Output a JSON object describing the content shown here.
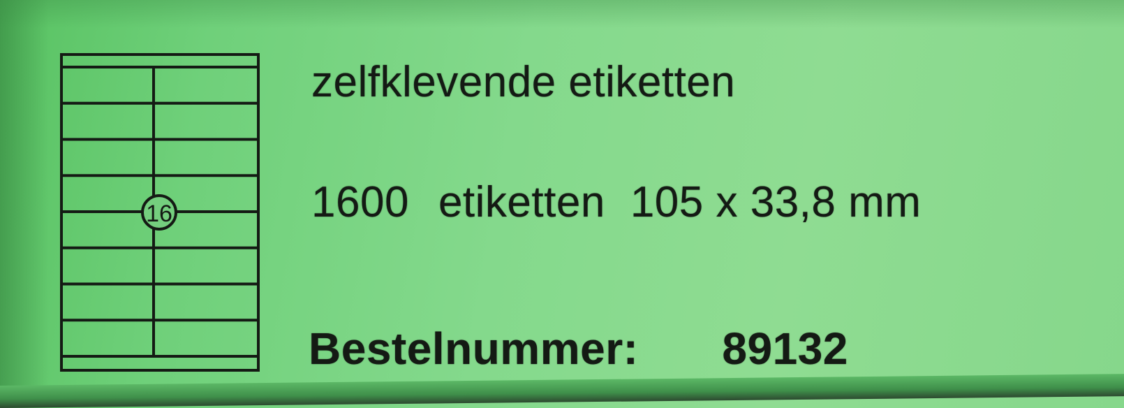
{
  "product": {
    "title": "zelfklevende etiketten",
    "count": "1600",
    "unit_word": "etiketten",
    "dimensions": "105 x 33,8 mm",
    "order_label": "Bestelnummer:",
    "order_number": "89132"
  },
  "sheet_diagram": {
    "labels_per_sheet": "16",
    "columns": 2,
    "rows": 8
  },
  "colors": {
    "label_green": "#7fd686",
    "ink": "#141a14"
  }
}
